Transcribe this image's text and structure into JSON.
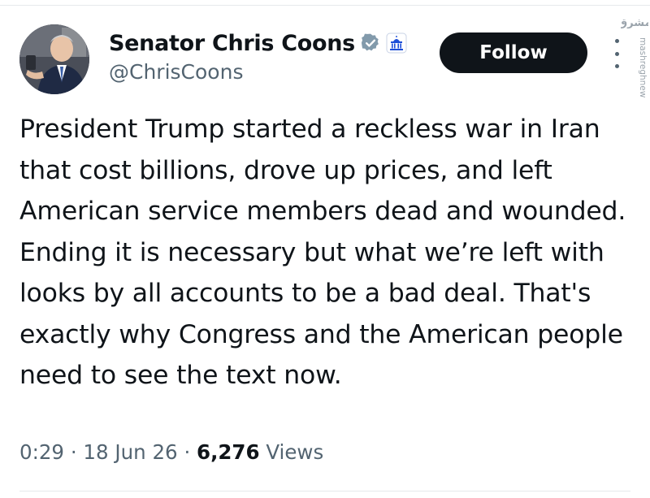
{
  "tweet": {
    "author": {
      "display_name": "Senator Chris Coons",
      "handle": "@ChrisCoons",
      "verified_color": "#829aab",
      "badge_color": "#1d4ed8"
    },
    "follow_label": "Follow",
    "text": "President Trump started a reckless war in Iran that cost billions, drove up prices, and left American service members dead and wounded. Ending it is necessary but what we’re left with looks by all accounts to be a bad deal. That's exactly why Congress and the American people need to see the text now.",
    "time": "0:29",
    "separator1": "·",
    "date": "18 Jun 26",
    "separator2": "·",
    "views_count": "6,276",
    "views_label": "Views"
  },
  "watermark": {
    "script_text": "مشرق",
    "site": "mashreghnews.ir"
  },
  "colors": {
    "text_primary": "#0f1419",
    "text_secondary": "#536471",
    "follow_bg": "#0f1419",
    "follow_text": "#ffffff"
  }
}
